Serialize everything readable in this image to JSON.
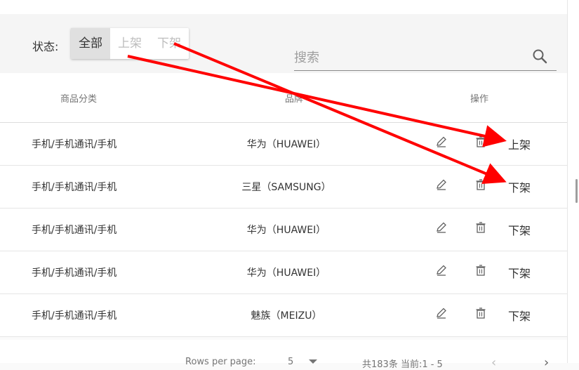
{
  "toolbar": {
    "status_label": "状态:",
    "filters": [
      "全部",
      "上架",
      "下架"
    ],
    "active_filter": "全部",
    "search_placeholder": "搜索"
  },
  "table": {
    "headers": {
      "category": "商品分类",
      "brand": "品牌",
      "actions": "操作"
    },
    "rows": [
      {
        "category": "手机/手机通讯/手机",
        "brand": "华为（HUAWEI）",
        "toggle": "上架"
      },
      {
        "category": "手机/手机通讯/手机",
        "brand": "三星（SAMSUNG）",
        "toggle": "下架"
      },
      {
        "category": "手机/手机通讯/手机",
        "brand": "华为（HUAWEI）",
        "toggle": "下架"
      },
      {
        "category": "手机/手机通讯/手机",
        "brand": "华为（HUAWEI）",
        "toggle": "下架"
      },
      {
        "category": "手机/手机通讯/手机",
        "brand": "魅族（MEIZU）",
        "toggle": "下架"
      }
    ]
  },
  "footer": {
    "rows_per_page_label": "Rows per page:",
    "rows_per_page_value": "5",
    "range_text": "共183条 当前:1 - 5",
    "prev_glyph": "‹",
    "next_glyph": "›"
  },
  "colors": {
    "annotation_arrow": "#ff0000",
    "active_segment": "#e0e0e0"
  },
  "icons": {
    "search": "search-icon",
    "edit": "pencil-icon",
    "delete": "trash-icon"
  }
}
